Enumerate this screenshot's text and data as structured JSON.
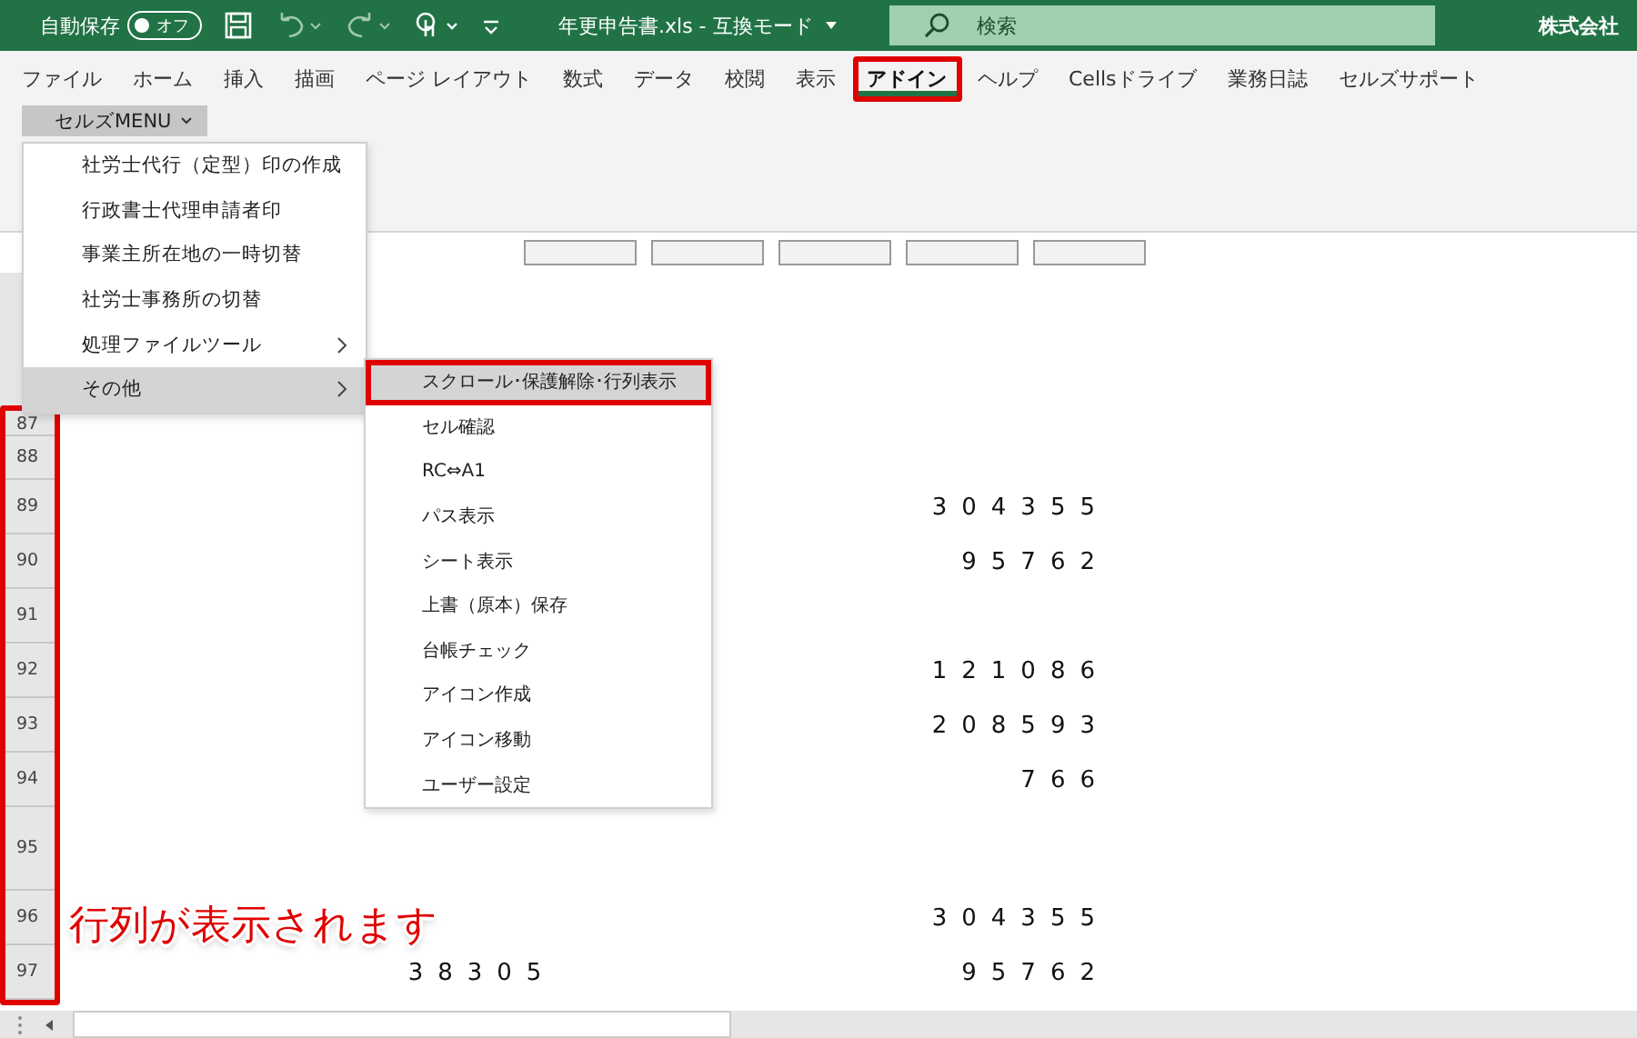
{
  "title_bar": {
    "autosave_label": "自動保存",
    "autosave_toggle": {
      "label": "オフ",
      "on": false
    },
    "filename": "年更申告書.xls - 互換モード",
    "search": {
      "placeholder": "検索"
    },
    "account": "株式会社"
  },
  "tabs": [
    {
      "label": "ファイル",
      "selected": false,
      "outlined": false
    },
    {
      "label": "ホーム",
      "selected": false,
      "outlined": false
    },
    {
      "label": "挿入",
      "selected": false,
      "outlined": false
    },
    {
      "label": "描画",
      "selected": false,
      "outlined": false
    },
    {
      "label": "ページ レイアウト",
      "selected": false,
      "outlined": false
    },
    {
      "label": "数式",
      "selected": false,
      "outlined": false
    },
    {
      "label": "データ",
      "selected": false,
      "outlined": false
    },
    {
      "label": "校閲",
      "selected": false,
      "outlined": false
    },
    {
      "label": "表示",
      "selected": false,
      "outlined": false
    },
    {
      "label": "アドイン",
      "selected": true,
      "outlined": true
    },
    {
      "label": "ヘルプ",
      "selected": false,
      "outlined": false
    },
    {
      "label": "Cellsドライブ",
      "selected": false,
      "outlined": false
    },
    {
      "label": "業務日誌",
      "selected": false,
      "outlined": false
    },
    {
      "label": "セルズサポート",
      "selected": false,
      "outlined": false
    }
  ],
  "ribbon": {
    "menu_button": "セルズMENU"
  },
  "menu": {
    "items": [
      {
        "label": "社労士代行（定型）印の作成",
        "has_submenu": false,
        "selected": false
      },
      {
        "label": "行政書士代理申請者印",
        "has_submenu": false,
        "selected": false
      },
      {
        "label": "事業主所在地の一時切替",
        "has_submenu": false,
        "selected": false
      },
      {
        "label": "社労士事務所の切替",
        "has_submenu": false,
        "selected": false
      },
      {
        "label": "処理ファイルツール",
        "has_submenu": true,
        "selected": false
      },
      {
        "label": "その他",
        "has_submenu": true,
        "selected": true
      }
    ]
  },
  "submenu": {
    "items": [
      {
        "label": "スクロール･保護解除･行列表示",
        "selected": true,
        "outlined": true
      },
      {
        "label": "セル確認",
        "selected": false,
        "outlined": false
      },
      {
        "label": "RC⇔A1",
        "selected": false,
        "outlined": false
      },
      {
        "label": "パス表示",
        "selected": false,
        "outlined": false
      },
      {
        "label": "シート表示",
        "selected": false,
        "outlined": false
      },
      {
        "label": "上書（原本）保存",
        "selected": false,
        "outlined": false
      },
      {
        "label": "台帳チェック",
        "selected": false,
        "outlined": false
      },
      {
        "label": "アイコン作成",
        "selected": false,
        "outlined": false
      },
      {
        "label": "アイコン移動",
        "selected": false,
        "outlined": false
      },
      {
        "label": "ユーザー設定",
        "selected": false,
        "outlined": false
      }
    ]
  },
  "sheet": {
    "row_headers_outlined": true,
    "rows": [
      {
        "number": "87",
        "kind": "short"
      },
      {
        "number": "88",
        "kind": "medium"
      },
      {
        "number": "89",
        "kind": "normal",
        "column_2": "304355"
      },
      {
        "number": "90",
        "kind": "normal",
        "column_2": "95762"
      },
      {
        "number": "91",
        "kind": "normal"
      },
      {
        "number": "92",
        "kind": "normal",
        "column_2": "121086"
      },
      {
        "number": "93",
        "kind": "normal",
        "column_2": "208593"
      },
      {
        "number": "94",
        "kind": "normal",
        "column_2": "766"
      },
      {
        "number": "95",
        "kind": "tall"
      },
      {
        "number": "96",
        "kind": "normal",
        "column_2": "304355"
      },
      {
        "number": "97",
        "kind": "normal",
        "column_1": "38305",
        "column_2": "95762"
      }
    ]
  },
  "annotation": "行列が表示されます"
}
